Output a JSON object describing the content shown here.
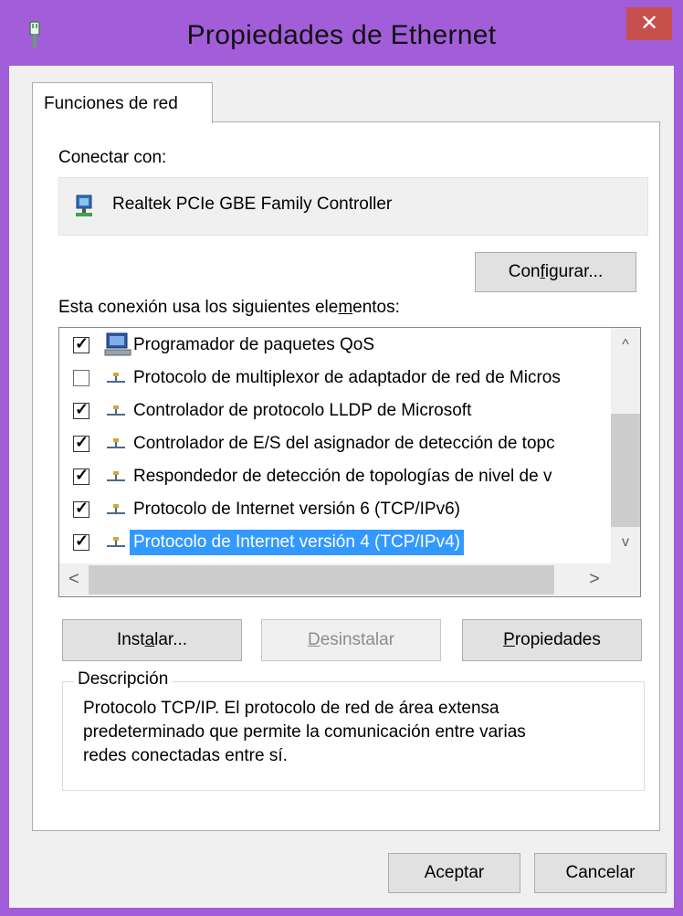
{
  "window": {
    "title": "Propiedades de Ethernet",
    "close_symbol": "✕"
  },
  "tabs": [
    {
      "label": "Funciones de red"
    }
  ],
  "connect": {
    "label": "Conectar con:",
    "adapter_name": "Realtek PCIe GBE Family Controller",
    "configure_button": {
      "pre": "Con",
      "ul": "f",
      "post": "igurar..."
    }
  },
  "items_label": {
    "pre": "Esta conexión usa los siguientes ele",
    "ul": "m",
    "post": "entos:"
  },
  "items": [
    {
      "label": "Programador de paquetes QoS",
      "checked": true,
      "icon": "qos-scheduler-icon"
    },
    {
      "label": "Protocolo de multiplexor de adaptador de red de Micros",
      "checked": false,
      "icon": "network-protocol-icon"
    },
    {
      "label": "Controlador de protocolo LLDP de Microsoft",
      "checked": true,
      "icon": "network-protocol-icon"
    },
    {
      "label": "Controlador de E/S del asignador de detección de topc",
      "checked": true,
      "icon": "network-protocol-icon"
    },
    {
      "label": "Respondedor de detección de topologías de nivel de v",
      "checked": true,
      "icon": "network-protocol-icon"
    },
    {
      "label": "Protocolo de Internet versión 6 (TCP/IPv6)",
      "checked": true,
      "icon": "network-protocol-icon"
    },
    {
      "label": "Protocolo de Internet versión 4 (TCP/IPv4)",
      "checked": true,
      "icon": "network-protocol-icon",
      "selected": true
    }
  ],
  "buttons": {
    "install": {
      "pre": "Inst",
      "ul": "a",
      "post": "lar..."
    },
    "uninstall": {
      "pre": "",
      "ul": "D",
      "post": "esinstalar"
    },
    "properties": {
      "pre": "",
      "ul": "P",
      "post": "ropiedades"
    }
  },
  "description": {
    "title": "Descripción",
    "lines": [
      "Protocolo TCP/IP. El protocolo de red de área extensa",
      "predeterminado que permite la comunicación entre varias",
      "redes conectadas entre sí."
    ]
  },
  "footer": {
    "ok": "Aceptar",
    "cancel": "Cancelar"
  },
  "colors": {
    "title_bar": "#a25dd8",
    "close_button": "#c7504c",
    "selection": "#3399ff"
  }
}
